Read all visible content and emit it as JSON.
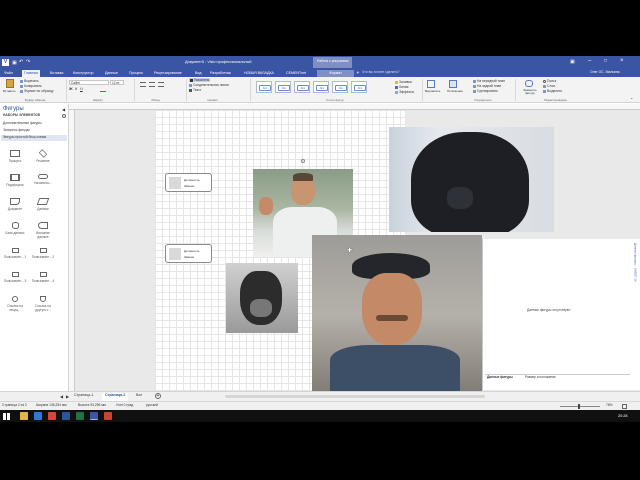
{
  "title_bar": {
    "document_title": "Документ5 - Visio профессиональный",
    "context_group": "Работа с рисунками",
    "tell_me": "Что вы хотите сделать?",
    "user": "Олег ОС. Малкина"
  },
  "tabs": [
    {
      "label": "Файл",
      "active": false
    },
    {
      "label": "Главная",
      "active": true
    },
    {
      "label": "Вставка",
      "active": false
    },
    {
      "label": "Конструктор",
      "active": false
    },
    {
      "label": "Данные",
      "active": false
    },
    {
      "label": "Процесс",
      "active": false
    },
    {
      "label": "Рецензирование",
      "active": false
    },
    {
      "label": "Вид",
      "active": false
    },
    {
      "label": "Разработчик",
      "active": false
    },
    {
      "label": "НОВАЯ ВКЛАДКА",
      "active": false
    },
    {
      "label": "CEMENTnet",
      "active": false
    },
    {
      "label": "Формат",
      "active": false,
      "contextual": true
    }
  ],
  "ribbon": {
    "clipboard": {
      "paste": "Вставить",
      "cut": "Вырезать",
      "copy": "Копировать",
      "format_painter": "Формат по образцу",
      "group": "Буфер обмена"
    },
    "font": {
      "name": "Calibri",
      "size": "12 пт.",
      "group": "Шрифт"
    },
    "paragraph": {
      "group": "Абзац"
    },
    "tools": {
      "pointer": "Указатель",
      "connector": "Соединительная линия",
      "text": "Текст",
      "group": "Сервис"
    },
    "shape_styles": {
      "items": [
        "Abc",
        "Abc",
        "Abc",
        "Abc",
        "Abc",
        "Abc"
      ],
      "group": "Стили фигур"
    },
    "fill": "Заливка",
    "line": "Линия",
    "effects": "Эффекты",
    "align": "Выровнять",
    "position": "Положение",
    "front": "На передний план",
    "back": "На задний план",
    "group_btn": "Группировать",
    "arrange_group": "Упорядочить",
    "change_shape": "Заменить фигуру",
    "find": "Поиск",
    "layers": "Слои",
    "select": "Выделить",
    "editing_group": "Редактирование"
  },
  "left_pane": {
    "title": "Фигуры",
    "stencils_header": "НАБОРЫ ЭЛЕМЕНТОВ",
    "more_shapes": "Дополнительные фигуры",
    "quick_shapes": "Экспресс-фигуры",
    "active_stencil": "Фигуры простой блок-схемы",
    "shapes": [
      {
        "label": "Процесс"
      },
      {
        "label": "Решение"
      },
      {
        "label": "Подпроцесс"
      },
      {
        "label": "Начало/ко..."
      },
      {
        "label": "Документ"
      },
      {
        "label": "Данные"
      },
      {
        "label": "База данных"
      },
      {
        "label": "Внешние данные"
      },
      {
        "label": "Пользовате... 1"
      },
      {
        "label": "Пользовате... 2"
      },
      {
        "label": "Пользовате... 3"
      },
      {
        "label": "Пользовате... 4"
      },
      {
        "label": "Ссылка на текущ..."
      },
      {
        "label": "Ссылка на другую с..."
      }
    ]
  },
  "canvas": {
    "position_boxes": [
      {
        "role": "Должность",
        "name": "Звание"
      },
      {
        "role": "Должность",
        "name": "Звание"
      }
    ]
  },
  "data_pane": {
    "vertical_title": "Данные фигуры - SHEET.16",
    "message": "Данные фигуры отсутствуют",
    "footer_left": "Данные фигуры",
    "footer_right": "Размер и положение"
  },
  "page_tabs": {
    "tabs": [
      "Страница-1",
      "Страница-2",
      "Все"
    ],
    "active_index": 1
  },
  "status_bar": {
    "page": "Страница 2 из 2",
    "width": "Ширина 136,254 мм",
    "height": "Высота 93,296 мм",
    "angle": "Угол 0 град",
    "language": "русский",
    "zoom": "76%"
  },
  "taskbar": {
    "time": "20:28"
  },
  "colors": {
    "accent": "#3955a3",
    "ribbon_bg": "#f3f3f3",
    "stencil_highlight": "#dfe5f3"
  }
}
